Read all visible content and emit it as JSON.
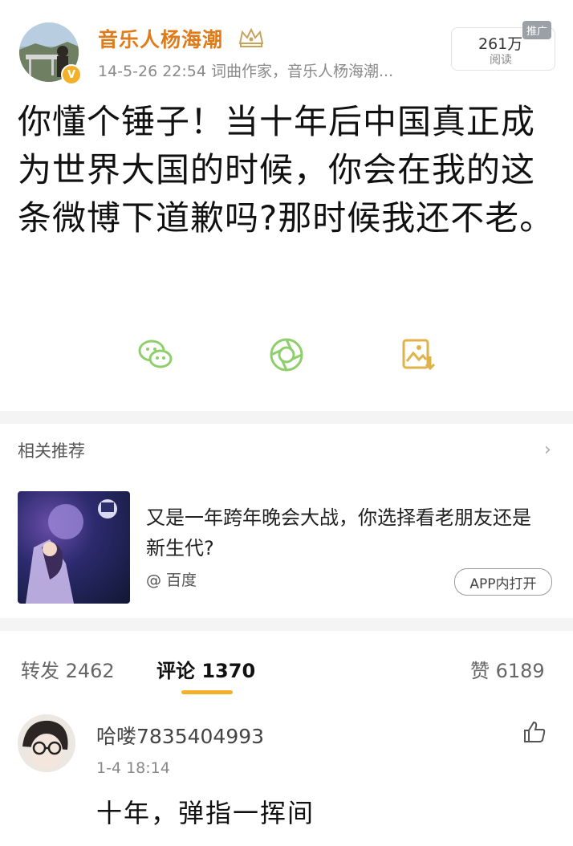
{
  "post": {
    "username": "音乐人杨海潮",
    "meta": "14-5-26 22:54  词曲作家，音乐人杨海潮...",
    "ad_tag": "推广",
    "views": "261万",
    "views_label": "阅读",
    "text": "你懂个锤子！当十年后中国真正成为世界大国的时候，你会在我的这条微博下道歉吗?那时候我还不老。",
    "share_icons": [
      "wechat-icon",
      "moments-icon",
      "save-image-icon"
    ]
  },
  "recommend": {
    "title": "相关推荐",
    "headline": "又是一年跨年晚会大战，你选择看老朋友还是新生代?",
    "source": "@ 百度",
    "app_button": "APP内打开"
  },
  "tabs": {
    "repost": "转发 2462",
    "comments": "评论 1370",
    "likes": "赞 6189"
  },
  "comment": {
    "name": "哈喽7835404993",
    "time": "1-4 18:14",
    "text": "十年，弹指一挥间"
  },
  "colors": {
    "username": "#e07b1a",
    "accent": "#f3b02a",
    "share_icon": "#8fcf6b"
  }
}
